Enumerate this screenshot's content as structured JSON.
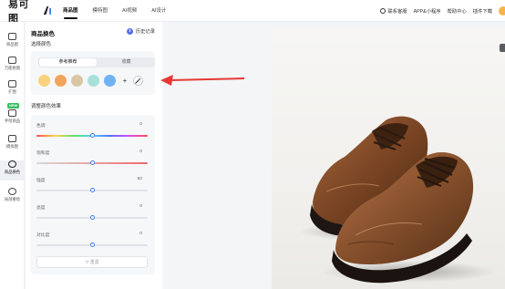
{
  "topbar": {
    "logo_text": "易可图",
    "nav": [
      "商品图",
      "模特图",
      "AI视频",
      "AI设计"
    ],
    "right": [
      "联系客服",
      "APP&小程序",
      "帮助中心",
      "插件下载"
    ]
  },
  "rail": {
    "new_badge": "NEW",
    "items": [
      {
        "label": "商品图",
        "icon": "image-icon"
      },
      {
        "label": "万能抠图",
        "icon": "cutout-icon"
      },
      {
        "label": "扩图",
        "icon": "expand-icon"
      },
      {
        "label": "手绘商品",
        "icon": "brush-icon"
      },
      {
        "label": "模拟图",
        "icon": "layers-icon"
      },
      {
        "label": "商品换色",
        "icon": "palette-icon"
      },
      {
        "label": "局部重绘",
        "icon": "repaint-icon"
      }
    ]
  },
  "panel": {
    "title": "商品换色",
    "history_label": "历史记录",
    "choose_color_label": "选择颜色",
    "tabs": [
      "参考推荐",
      "收藏"
    ],
    "swatch_colors": [
      "#f8d27c",
      "#f3a45c",
      "#d9c6a4",
      "#a8e0d8",
      "#6fb3f2"
    ],
    "adjust_label": "调整颜色效果",
    "sliders": [
      {
        "name": "色调",
        "value": 0,
        "fill": 0.5
      },
      {
        "name": "饱和度",
        "value": 0,
        "fill": 0.5
      },
      {
        "name": "强度",
        "value": 50,
        "fill": 0.5
      },
      {
        "name": "亮度",
        "value": 0,
        "fill": 0.5
      },
      {
        "name": "对比度",
        "value": 0,
        "fill": 0.5
      }
    ],
    "reset_label": "重置"
  },
  "colors": {
    "accent": "#3f7bf3",
    "arrow": "#e53935",
    "active_tab_text": "#222222"
  }
}
